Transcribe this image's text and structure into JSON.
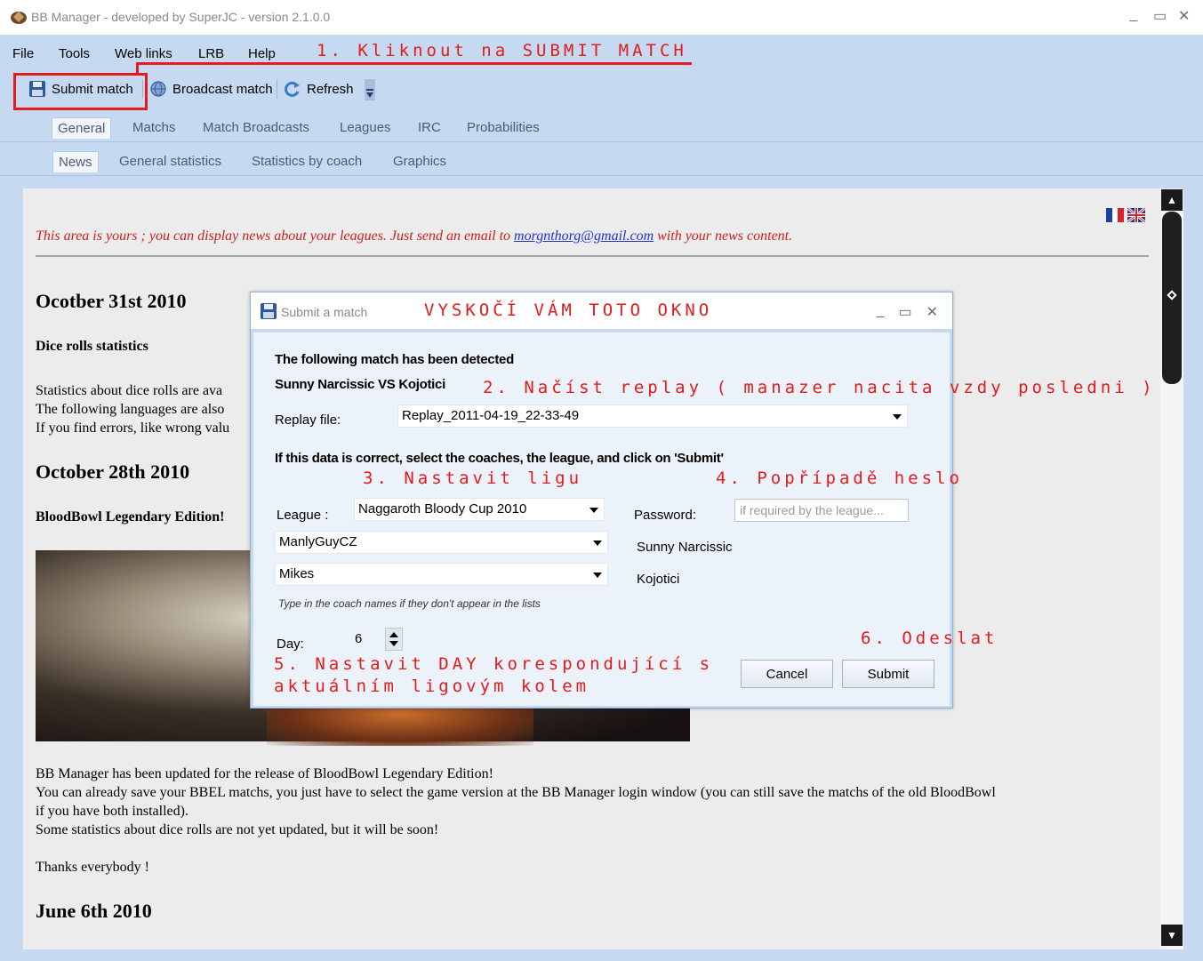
{
  "window": {
    "title": "BB Manager - developed by SuperJC - version 2.1.0.0",
    "controls": {
      "minimize": "_",
      "maximize": "▭",
      "close": "✕"
    }
  },
  "menu": [
    "File",
    "Tools",
    "Web links",
    "LRB",
    "Help"
  ],
  "toolbar": {
    "submit_match": "Submit match",
    "broadcast_match": "Broadcast match",
    "refresh": "Refresh"
  },
  "main_tabs": [
    "General",
    "Matchs",
    "Match Broadcasts",
    "Leagues",
    "IRC",
    "Probabilities"
  ],
  "sub_tabs": [
    "News",
    "General statistics",
    "Statistics by coach",
    "Graphics"
  ],
  "news": {
    "intro_before": "This area is yours ; you can display news about your leagues. Just send an email to ",
    "intro_email": "morgnthorg@gmail.com",
    "intro_after": " with your news content.",
    "sections": [
      {
        "date": "Ocotber 31st 2010",
        "subtitle": "Dice rolls statistics",
        "lines": [
          "Statistics about dice rolls are ava",
          "The following languages are also",
          "If you find errors, like wrong valu"
        ]
      },
      {
        "date": "October 28th 2010",
        "subtitle": "BloodBowl Legendary Edition!",
        "lines": [
          "BB Manager has been updated for the release of BloodBowl Legendary Edition!",
          "You can already save your BBEL matchs, you just have to select the game version at the BB Manager login window (you can still save the matchs of the old BloodBowl",
          "if you have both installed).",
          "Some statistics about dice rolls are not yet updated, but it will be soon!",
          "",
          "Thanks everybody !"
        ]
      },
      {
        "date": "June 6th 2010"
      }
    ]
  },
  "dialog": {
    "title": "Submit a match",
    "controls": {
      "minimize": "_",
      "maximize": "▭",
      "close": "✕"
    },
    "detected": "The following match has been detected",
    "match": "Sunny Narcissic VS Kojotici",
    "replay_label": "Replay file:",
    "replay_value": "Replay_2011-04-19_22-33-49",
    "instruction": "If this data is correct, select the coaches, the league, and click on 'Submit'",
    "league_label": "League :",
    "league_value": "Naggaroth Bloody Cup 2010",
    "password_label": "Password:",
    "password_placeholder": "if required by the league...",
    "coach1_value": "ManlyGuyCZ",
    "team1": "Sunny Narcissic",
    "coach2_value": "Mikes",
    "team2": "Kojotici",
    "hint": "Type in the coach names if they don't appear in the lists",
    "day_label": "Day:",
    "day_value": "6",
    "cancel": "Cancel",
    "submit": "Submit"
  },
  "annotations": {
    "step1": "1. Kliknout na SUBMIT MATCH",
    "popup": "VYSKOČÍ VÁM TOTO OKNO",
    "step2": "2. Načíst replay ( manazer nacita vzdy posledni )",
    "step3": "3. Nastavit ligu",
    "step4": "4. Popřípadě heslo",
    "step5_line1": "5. Nastavit DAY korespondující s",
    "step5_line2": "aktuálním ligovým kolem",
    "step6": "6. Odeslat",
    "color": "#e21b1b"
  }
}
